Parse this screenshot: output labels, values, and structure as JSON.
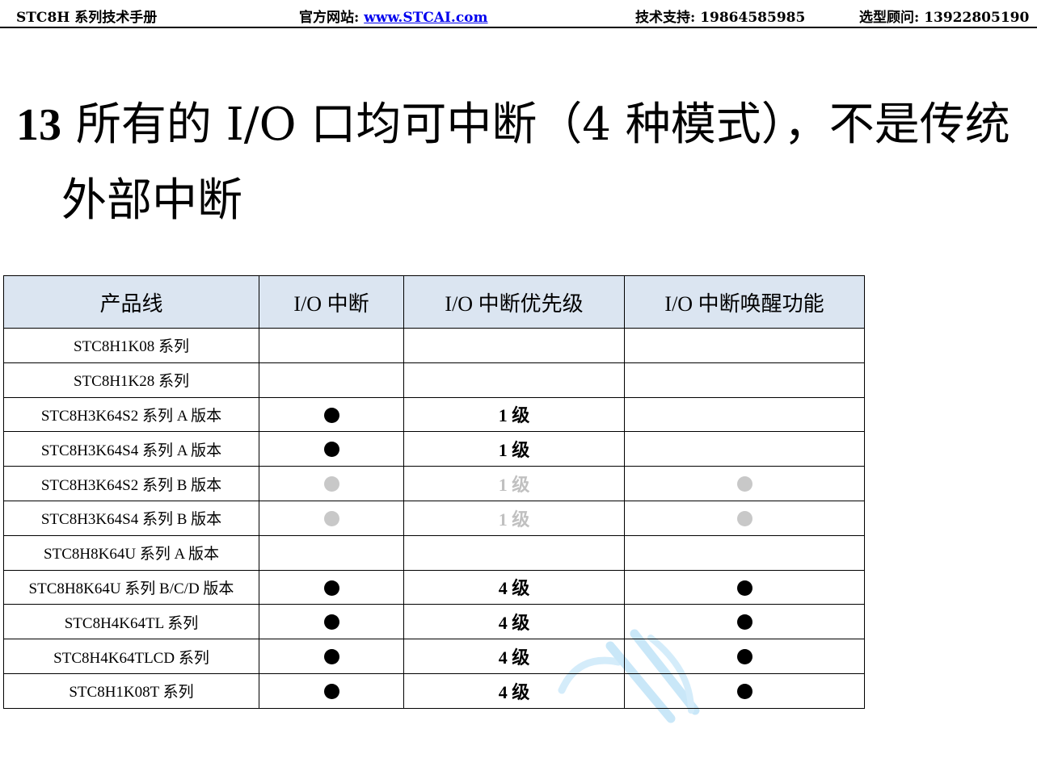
{
  "header": {
    "doc_title": "STC8H 系列技术手册",
    "site_label": "官方网站: ",
    "site_url": "www.STCAI.com",
    "support": "技术支持: 19864585985",
    "consult": "选型顾问: 13922805190"
  },
  "section": {
    "number": "13",
    "title_line1": "所有的 I/O 口均可中断（4 种模式），不是传统",
    "title_line2": "外部中断"
  },
  "table": {
    "headers": [
      "产品线",
      "I/O 中断",
      "I/O 中断优先级",
      "I/O 中断唤醒功能"
    ],
    "rows": [
      {
        "name": "STC8H1K08 系列",
        "io_int": "",
        "priority": "",
        "wakeup": ""
      },
      {
        "name": "STC8H1K28 系列",
        "io_int": "",
        "priority": "",
        "wakeup": ""
      },
      {
        "name": "STC8H3K64S2 系列 A 版本",
        "io_int": "black",
        "priority": "1 级",
        "priority_style": "black",
        "wakeup": ""
      },
      {
        "name": "STC8H3K64S4 系列 A 版本",
        "io_int": "black",
        "priority": "1 级",
        "priority_style": "black",
        "wakeup": ""
      },
      {
        "name": "STC8H3K64S2 系列 B 版本",
        "io_int": "grey",
        "priority": "1 级",
        "priority_style": "grey",
        "wakeup": "grey"
      },
      {
        "name": "STC8H3K64S4 系列 B 版本",
        "io_int": "grey",
        "priority": "1 级",
        "priority_style": "grey",
        "wakeup": "grey"
      },
      {
        "name": "STC8H8K64U 系列 A 版本",
        "io_int": "",
        "priority": "",
        "wakeup": ""
      },
      {
        "name": "STC8H8K64U 系列 B/C/D 版本",
        "io_int": "black",
        "priority": "4 级",
        "priority_style": "black",
        "wakeup": "black"
      },
      {
        "name": "STC8H4K64TL 系列",
        "io_int": "black",
        "priority": "4 级",
        "priority_style": "black",
        "wakeup": "black"
      },
      {
        "name": "STC8H4K64TLCD 系列",
        "io_int": "black",
        "priority": "4 级",
        "priority_style": "black",
        "wakeup": "black"
      },
      {
        "name": "STC8H1K08T 系列",
        "io_int": "black",
        "priority": "4 级",
        "priority_style": "black",
        "wakeup": "black"
      }
    ]
  },
  "colors": {
    "header_fill": "#dbe5f1",
    "dot_black": "#000000",
    "dot_grey": "#c8c8c8",
    "watermark": "#bfe3f7"
  }
}
